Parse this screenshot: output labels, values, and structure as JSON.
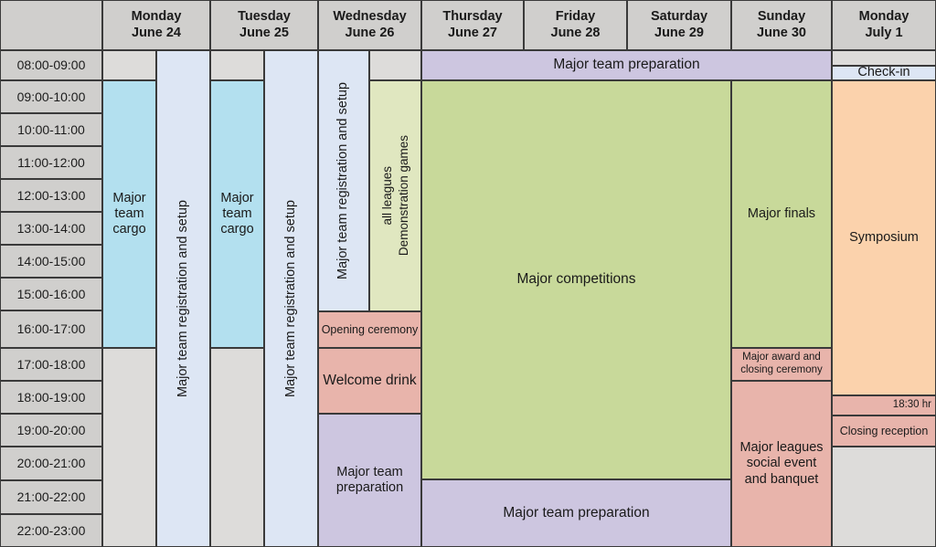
{
  "grid": {
    "corner_label": "",
    "columns": [
      {
        "day": "Monday",
        "date": "June 24"
      },
      {
        "day": "Tuesday",
        "date": "June 25"
      },
      {
        "day": "Wednesday",
        "date": "June 26"
      },
      {
        "day": "Thursday",
        "date": "June 27"
      },
      {
        "day": "Friday",
        "date": "June 28"
      },
      {
        "day": "Saturday",
        "date": "June 29"
      },
      {
        "day": "Sunday",
        "date": "June 30"
      },
      {
        "day": "Monday",
        "date": "July 1"
      }
    ],
    "time_slots": [
      "08:00-09:00",
      "09:00-10:00",
      "10:00-11:00",
      "11:00-12:00",
      "12:00-13:00",
      "13:00-14:00",
      "14:00-15:00",
      "15:00-16:00",
      "16:00-17:00",
      "17:00-18:00",
      "18:00-19:00",
      "19:00-20:00",
      "20:00-21:00",
      "21:00-22:00",
      "22:00-23:00"
    ]
  },
  "events": {
    "mon24_cargo": "Major team cargo",
    "mon24_reg": "Major team registration and setup",
    "tue25_cargo": "Major team cargo",
    "tue25_reg": "Major team registration and setup",
    "wed26_reg": "Major team registration and setup",
    "wed26_demo_l1": "Demonstration games",
    "wed26_demo_l2": "all leagues",
    "wed26_opening": "Opening ceremony",
    "wed26_welcome": "Welcome drink",
    "wed26_prep": "Major team preparation",
    "top_prep": "Major team preparation",
    "competitions": "Major competitions",
    "bottom_prep": "Major team preparation",
    "sun30_finals": "Major finals",
    "sun30_award": "Major award and closing ceremony",
    "sun30_banquet": "Major leagues social event and banquet",
    "jul1_checkin": "Check-in",
    "jul1_symposium": "Symposium",
    "jul1_time": "18:30 hr",
    "jul1_closing": "Closing reception"
  },
  "colors": {
    "header_bg": "#d0cfcd",
    "empty": "#dddcda",
    "cargo_blue": "#b3e0ef",
    "registration_lightblue": "#dde6f4",
    "preparation_purple": "#cdc6e0",
    "competition_green": "#c8d99a",
    "demo_lightgreen": "#e0e7c0",
    "ceremony_salmon": "#e8b4ab",
    "symposium_orange": "#fbd2ac",
    "border": "#3a3a3a"
  }
}
